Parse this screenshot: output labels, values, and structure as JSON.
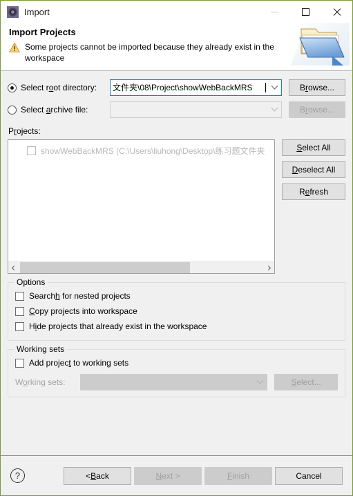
{
  "window": {
    "title": "Import",
    "title_icon": "import-gear-icon",
    "minimize_label": "—",
    "maximize_label": "□",
    "close_label": "✕",
    "border_color": "#7a9a36"
  },
  "header": {
    "title": "Import Projects",
    "warning_icon": "warning-triangle-icon",
    "message": "Some projects cannot be imported because they already exist in the workspace",
    "banner_icon": "open-folder-icon"
  },
  "source": {
    "root_directory": {
      "label_pre": "Select r",
      "label_mnemonic": "o",
      "label_post": "ot directory:",
      "selected": true,
      "value": "文件夹\\08\\Project\\showWebBackMRS",
      "browse_pre": "B",
      "browse_mnemonic": "r",
      "browse_post": "owse...",
      "browse_enabled": true
    },
    "archive_file": {
      "label_pre": "Select ",
      "label_mnemonic": "a",
      "label_post": "rchive file:",
      "selected": false,
      "value": "",
      "browse_pre": "B",
      "browse_mnemonic": "r",
      "browse_post": "owse...",
      "browse_enabled": false
    }
  },
  "projects": {
    "label_pre": "P",
    "label_mnemonic": "r",
    "label_post": "ojects:",
    "items": [
      {
        "text": "showWebBackMRS (C:\\Users\\liuhong\\Desktop\\练习题文件夹",
        "checked": false,
        "enabled": false
      }
    ],
    "scroll_thumb_percent": 70,
    "buttons": [
      {
        "pre": "",
        "mnemonic": "S",
        "post": "elect All",
        "enabled": true
      },
      {
        "pre": "",
        "mnemonic": "D",
        "post": "eselect All",
        "enabled": true
      },
      {
        "pre": "R",
        "mnemonic": "e",
        "post": "fresh",
        "enabled": true
      }
    ]
  },
  "options": {
    "title": "Options",
    "checkboxes": [
      {
        "pre": "Search",
        "mnemonic": "h",
        "post": " for nested projects",
        "checked": false
      },
      {
        "pre": "",
        "mnemonic": "C",
        "post": "opy projects into workspace",
        "checked": false
      },
      {
        "pre": "H",
        "mnemonic": "i",
        "post": "de projects that already exist in the workspace",
        "checked": false
      }
    ]
  },
  "working_sets": {
    "title": "Working sets",
    "add_checkbox": {
      "pre": "Add projec",
      "mnemonic": "t",
      "post": " to working sets",
      "checked": false
    },
    "combo_label_pre": "W",
    "combo_label_mnemonic": "o",
    "combo_label_post": "rking sets:",
    "combo_value": "",
    "combo_enabled": false,
    "select_pre": "",
    "select_mnemonic": "S",
    "select_post": "elect...",
    "select_enabled": false
  },
  "footer": {
    "help_icon": "question-mark-icon",
    "help_glyph": "?",
    "buttons": [
      {
        "pre": "< ",
        "mnemonic": "B",
        "post": "ack",
        "enabled": true
      },
      {
        "pre": "",
        "mnemonic": "N",
        "post": "ext >",
        "enabled": false
      },
      {
        "pre": "",
        "mnemonic": "F",
        "post": "inish",
        "enabled": false
      },
      {
        "pre": "",
        "mnemonic": "",
        "post": "Cancel",
        "enabled": true
      }
    ]
  }
}
